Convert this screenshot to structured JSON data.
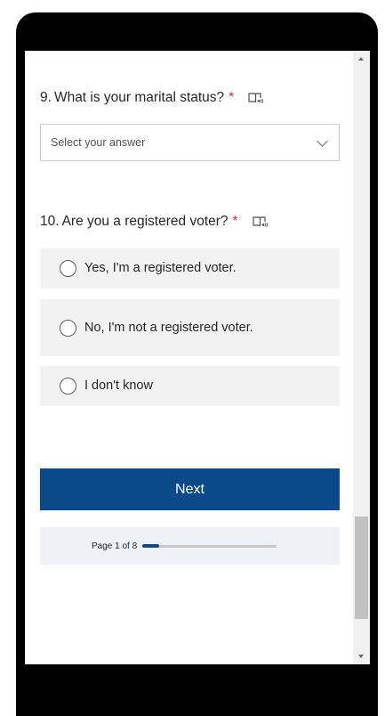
{
  "questions": [
    {
      "number": "9.",
      "text": "What is your marital status?",
      "required_mark": "*",
      "reader_icon": "immersive-reader-icon"
    },
    {
      "number": "10.",
      "text": "Are you a registered voter?",
      "required_mark": "*",
      "reader_icon": "immersive-reader-icon"
    }
  ],
  "marital_dropdown": {
    "value": "Select your answer",
    "icon": "chevron-down-icon"
  },
  "voter_options": [
    "Yes, I'm a registered voter.",
    "No, I'm not a registered voter.",
    "I don't know"
  ],
  "next_button": {
    "label": "Next"
  },
  "progress": {
    "label": "Page 1 of 8",
    "current_page": 1,
    "total_pages": 8
  },
  "colors": {
    "accent": "#0b4a8a",
    "required": "#c4314b",
    "option_background": "#f2f2f2",
    "progress_background": "#edf1f6"
  }
}
